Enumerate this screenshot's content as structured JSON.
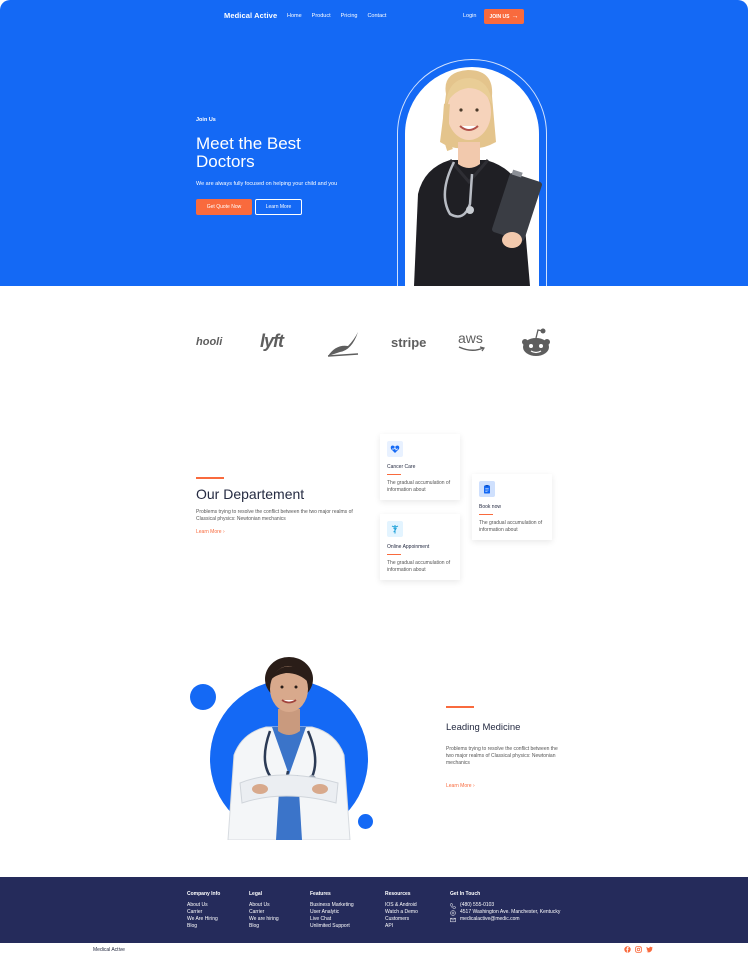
{
  "colors": {
    "primary": "#1469f5",
    "accent": "#f96a3d",
    "footer_bg": "#252b5b",
    "heading": "#252b42"
  },
  "header": {
    "brand": "Medical Active",
    "nav": [
      "Home",
      "Product",
      "Pricing",
      "Contact"
    ],
    "login": "Login",
    "join": "JOIN US"
  },
  "hero": {
    "eyebrow": "Join Us",
    "title": "Meet the Best Doctors",
    "subtitle": "We are always fully focused on helping your child and you",
    "primary_cta": "Get Quote Now",
    "secondary_cta": "Learn More"
  },
  "logos": {
    "hooli": "hooli",
    "lyft": "lyft",
    "stripe": "stripe",
    "aws": "aws"
  },
  "department": {
    "title": "Our Departement",
    "text": "Problems trying to resolve the conflict between the two major realms of Classical physics: Newtonian mechanics",
    "link": "Learn More",
    "cards": [
      {
        "icon": "heart-pulse-icon",
        "title": "Cancer Care",
        "text": "The gradual accumulation of information about"
      },
      {
        "icon": "caduceus-icon",
        "title": "Online Appoinment",
        "text": "The gradual accumulation of information about"
      },
      {
        "icon": "clipboard-icon",
        "title": "Book now",
        "text": "The gradual accumulation of information about"
      }
    ]
  },
  "leading": {
    "title": "Leading Medicine",
    "text": "Problems trying to resolve the conflict between the two major realms of Classical physics: Newtonian mechanics",
    "link": "Learn More"
  },
  "footer": {
    "columns": [
      {
        "heading": "Company Info",
        "items": [
          "About Us",
          "Carrier",
          "We Are Hiring",
          "Blog"
        ]
      },
      {
        "heading": "Legal",
        "items": [
          "About Us",
          "Carrier",
          "We are hiring",
          "Blog"
        ]
      },
      {
        "heading": "Features",
        "items": [
          "Business Marketing",
          "User Analytic",
          "Live Chat",
          "Unlimited Support"
        ]
      },
      {
        "heading": "Resources",
        "items": [
          "IOS & Android",
          "Watch a Demo",
          "Customers",
          "API"
        ]
      }
    ],
    "contact": {
      "heading": "Get In Touch",
      "phone": "(480) 555-0103",
      "address": "4517 Washington Ave. Manchester, Kentucky",
      "email": "medicalactive@medic.com"
    },
    "bottom_brand": "Medical Active",
    "socials": [
      "facebook-icon",
      "instagram-icon",
      "twitter-icon"
    ]
  }
}
